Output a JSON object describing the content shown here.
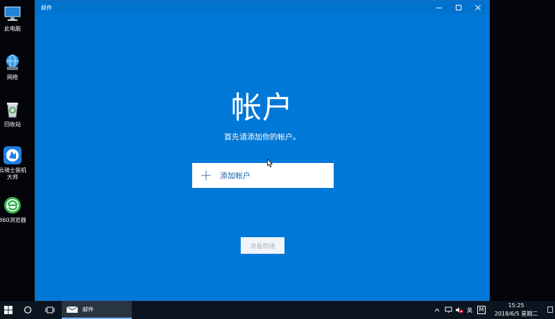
{
  "desktop": {
    "icons": [
      {
        "label": "此电脑"
      },
      {
        "label": "网络"
      },
      {
        "label": "回收站"
      },
      {
        "label": "云骑士装机大师"
      },
      {
        "label": "360浏览器"
      }
    ]
  },
  "window": {
    "title": "邮件",
    "heading": "帐户",
    "subtitle": "首先请添加你的帐户。",
    "add_account_label": "添加帐户",
    "ready_label": "准备就绪"
  },
  "taskbar": {
    "active_app_label": "邮件",
    "ime_label": "英",
    "ime_mode": "M",
    "time": "15:25",
    "date": "2018/6/5 星期二"
  },
  "colors": {
    "accent": "#0078d7",
    "taskbar": "#0b1520"
  }
}
